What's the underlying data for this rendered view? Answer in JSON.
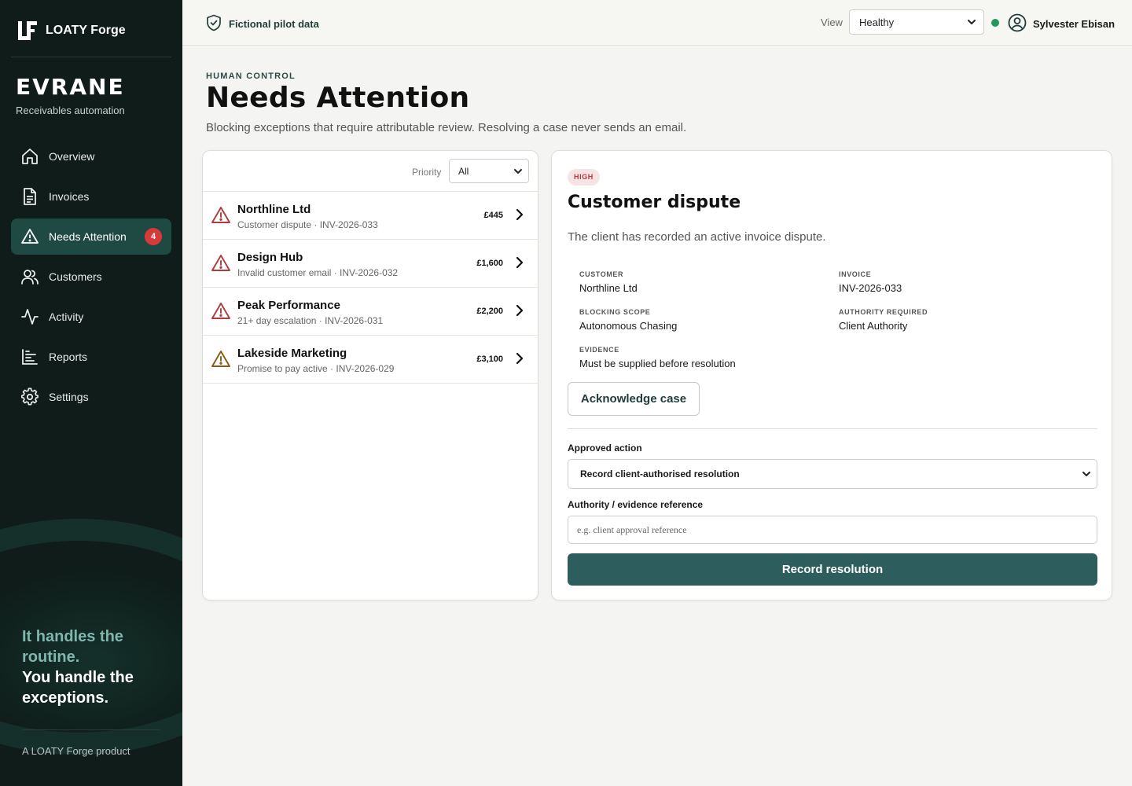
{
  "brand": {
    "name": "LOATY Forge"
  },
  "product": {
    "name": "EVRANE",
    "subtitle": "Receivables automation"
  },
  "sidebar": {
    "items": [
      {
        "label": "Overview",
        "icon": "home-icon"
      },
      {
        "label": "Invoices",
        "icon": "document-icon"
      },
      {
        "label": "Needs Attention",
        "icon": "warning-icon",
        "badge": "4",
        "active": true
      },
      {
        "label": "Customers",
        "icon": "users-icon"
      },
      {
        "label": "Activity",
        "icon": "activity-icon"
      },
      {
        "label": "Reports",
        "icon": "chart-icon"
      },
      {
        "label": "Settings",
        "icon": "gear-icon"
      }
    ],
    "tagline_line1": "It handles the routine.",
    "tagline_line2": "You handle the exceptions.",
    "footer": "A LOATY Forge product"
  },
  "topbar": {
    "pilot_label": "Fictional pilot data",
    "view_label": "View",
    "view_value": "Healthy",
    "status_color": "#1f9a5b",
    "user_name": "Sylvester Ebisan"
  },
  "page": {
    "eyebrow": "HUMAN CONTROL",
    "title": "Needs Attention",
    "description": "Blocking exceptions that require attributable review. Resolving a case never sends an email."
  },
  "list": {
    "filter_label": "Priority",
    "filter_value": "All",
    "cases": [
      {
        "name": "Northline Ltd",
        "subtitle": "Customer dispute · INV-2026-033",
        "amount": "£445",
        "severity": "high"
      },
      {
        "name": "Design Hub",
        "subtitle": "Invalid customer email · INV-2026-032",
        "amount": "£1,600",
        "severity": "high"
      },
      {
        "name": "Peak Performance",
        "subtitle": "21+ day escalation · INV-2026-031",
        "amount": "£2,200",
        "severity": "high"
      },
      {
        "name": "Lakeside Marketing",
        "subtitle": "Promise to pay active · INV-2026-029",
        "amount": "£3,100",
        "severity": "medium"
      }
    ]
  },
  "detail": {
    "priority_badge": "HIGH",
    "title": "Customer dispute",
    "description": "The client has recorded an active invoice dispute.",
    "customer_label": "CUSTOMER",
    "customer_value": "Northline Ltd",
    "invoice_label": "INVOICE",
    "invoice_value": "INV-2026-033",
    "scope_label": "BLOCKING SCOPE",
    "scope_value": "Autonomous Chasing",
    "authority_label": "AUTHORITY REQUIRED",
    "authority_value": "Client Authority",
    "evidence_label": "EVIDENCE",
    "evidence_value": "Must be supplied before resolution",
    "ack_button": "Acknowledge case",
    "action_label": "Approved action",
    "action_value": "Record client-authorised resolution",
    "reference_label": "Authority / evidence reference",
    "reference_placeholder": "e.g. client approval reference",
    "submit_button": "Record resolution"
  },
  "colors": {
    "sidebar_bg": "#0f1c19",
    "accent": "#2d5d5c",
    "danger": "#b13b3b",
    "warning": "#8a5a12"
  }
}
